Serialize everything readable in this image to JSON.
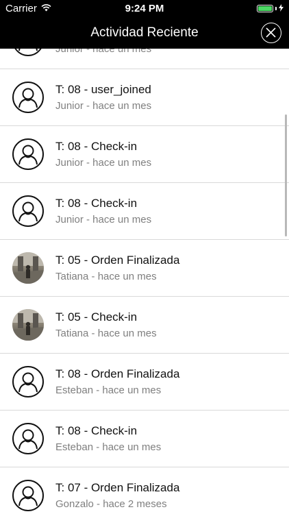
{
  "status_bar": {
    "carrier": "Carrier",
    "time": "9:24 PM",
    "battery_level": 1.0
  },
  "nav": {
    "title": "Actividad Reciente",
    "close_icon": "close-circle-icon"
  },
  "colors": {
    "bar_background": "#000000",
    "battery": "#4cd964",
    "subtitle": "#7f7f7f",
    "divider": "#d9d9d9"
  },
  "activities": [
    {
      "title": "",
      "subtitle": "Junior - hace un mes",
      "avatar": "default-user"
    },
    {
      "title": "T: 08 - user_joined",
      "subtitle": "Junior - hace un mes",
      "avatar": "default-user"
    },
    {
      "title": "T: 08 - Check-in",
      "subtitle": "Junior - hace un mes",
      "avatar": "default-user"
    },
    {
      "title": "T: 08 - Check-in",
      "subtitle": "Junior - hace un mes",
      "avatar": "default-user"
    },
    {
      "title": "T: 05 - Orden Finalizada",
      "subtitle": "Tatiana - hace un mes",
      "avatar": "photo"
    },
    {
      "title": "T: 05 - Check-in",
      "subtitle": "Tatiana - hace un mes",
      "avatar": "photo"
    },
    {
      "title": "T: 08 - Orden Finalizada",
      "subtitle": "Esteban - hace un mes",
      "avatar": "default-user"
    },
    {
      "title": "T: 08 - Check-in",
      "subtitle": "Esteban - hace un mes",
      "avatar": "default-user"
    },
    {
      "title": "T: 07 - Orden Finalizada",
      "subtitle": "Gonzalo - hace 2 meses",
      "avatar": "default-user"
    }
  ]
}
